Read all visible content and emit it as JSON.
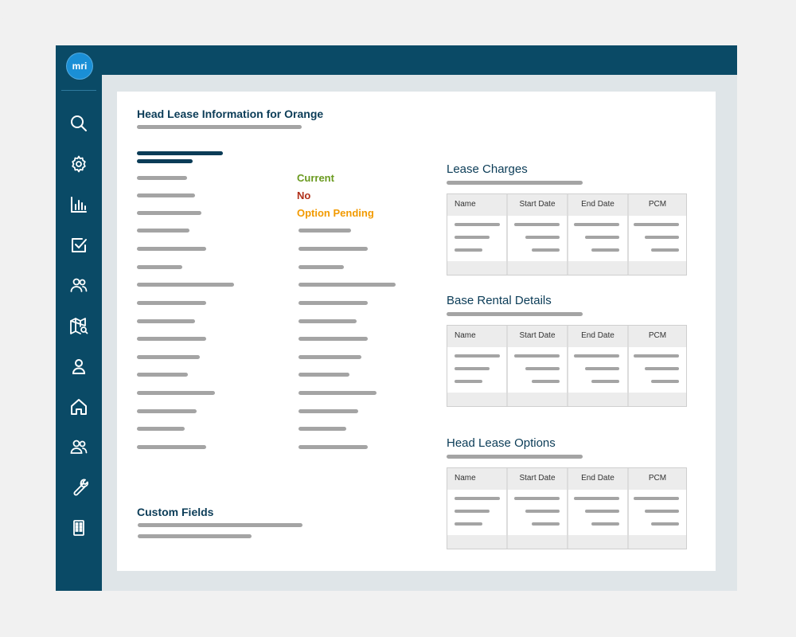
{
  "app": {
    "logo_text": "mri",
    "nav_icons": [
      "search-icon",
      "settings-icon",
      "chart-icon",
      "checkbox-icon",
      "users-icon",
      "map-search-icon",
      "user-icon",
      "home-icon",
      "team-icon",
      "wrench-icon",
      "building-icon"
    ]
  },
  "page": {
    "title": "Head Lease Information for Orange",
    "status": {
      "current": "Current",
      "no": "No",
      "option_pending": "Option Pending"
    },
    "custom_fields_title": "Custom Fields"
  },
  "tables": [
    {
      "title": "Lease Charges",
      "columns": [
        "Name",
        "Start Date",
        "End Date",
        "PCM"
      ]
    },
    {
      "title": "Base Rental Details",
      "columns": [
        "Name",
        "Start Date",
        "End Date",
        "PCM"
      ]
    },
    {
      "title": "Head Lease Options",
      "columns": [
        "Name",
        "Start Date",
        "End Date",
        "PCM"
      ]
    }
  ],
  "colors": {
    "navy": "#0a4a66",
    "title": "#0b3c57",
    "current": "#6a9a1f",
    "no": "#b0301a",
    "option_pending": "#f29a00",
    "placeholder": "#a4a4a4"
  }
}
